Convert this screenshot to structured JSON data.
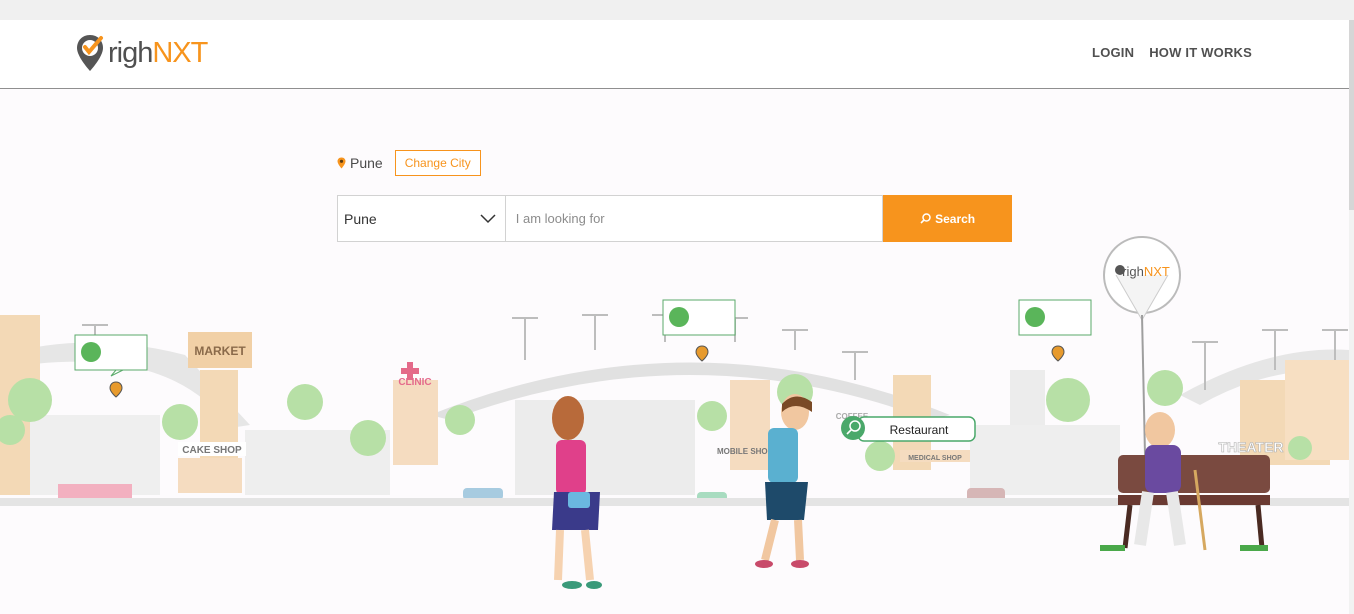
{
  "app": {
    "logo_text_right": "righ",
    "logo_text_nxt": "NXT"
  },
  "nav": {
    "login": "LOGIN",
    "how_it_works": "HOW IT WORKS"
  },
  "location": {
    "city": "Pune",
    "change_city_label": "Change City"
  },
  "search": {
    "city_value": "Pune",
    "placeholder": "I am looking for",
    "button_label": "Search"
  },
  "illustration": {
    "market_sign": "MARKET",
    "clinic_sign": "CLINIC",
    "cake_shop_sign": "CAKE SHOP",
    "mobile_shop_sign": "MOBILE SHOP",
    "coffee_sign": "COFFEE",
    "medical_shop_sign": "MEDICAL SHOP",
    "theater_sign": "THEATER",
    "restaurant_bubble": "Restaurant",
    "balloon_logo_righ": "righ",
    "balloon_logo_nxt": "NXT"
  },
  "colors": {
    "accent": "#f7941d",
    "text": "#505050",
    "building_tan": "#f5d5a8",
    "tree_green": "#a8d99a"
  }
}
